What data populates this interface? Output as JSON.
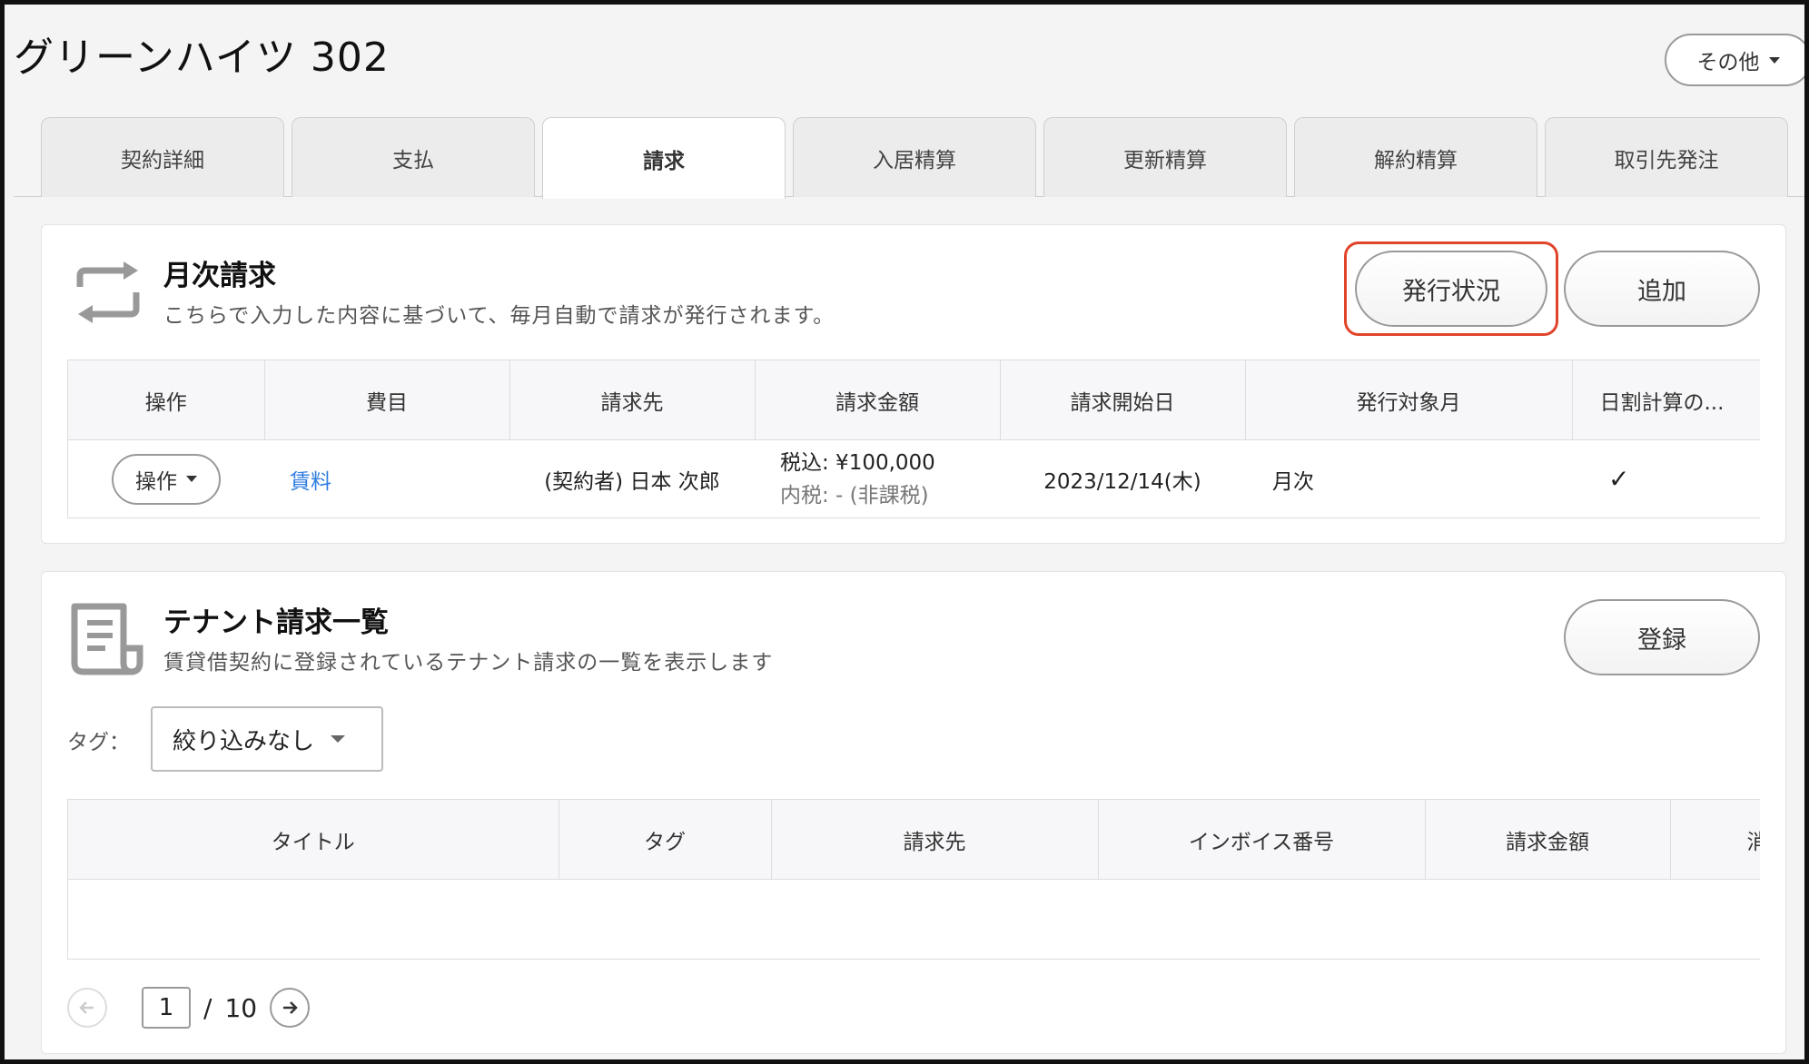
{
  "page": {
    "title": "グリーンハイツ 302",
    "other_label": "その他"
  },
  "tabs": [
    {
      "label": "契約詳細",
      "active": false
    },
    {
      "label": "支払",
      "active": false
    },
    {
      "label": "請求",
      "active": true
    },
    {
      "label": "入居精算",
      "active": false
    },
    {
      "label": "更新精算",
      "active": false
    },
    {
      "label": "解約精算",
      "active": false
    },
    {
      "label": "取引先発注",
      "active": false
    }
  ],
  "monthly": {
    "title": "月次請求",
    "description": "こちらで入力した内容に基づいて、毎月自動で請求が発行されます。",
    "status_button": "発行状況",
    "add_button": "追加",
    "columns": [
      "操作",
      "費目",
      "請求先",
      "請求金額",
      "請求開始日",
      "発行対象月",
      "日割計算の..."
    ],
    "rows": [
      {
        "action": "操作",
        "item": "賃料",
        "billing_to": "(契約者) 日本 次郎",
        "amount_main": "税込: ¥100,000",
        "amount_sub": "内税: - (非課税)",
        "start_date": "2023/12/14(木)",
        "target_month": "月次",
        "prorate": "✓"
      }
    ]
  },
  "tenant": {
    "title": "テナント請求一覧",
    "description": "賃貸借契約に登録されているテナント請求の一覧を表示します",
    "register_button": "登録",
    "tag_label": "タグ：",
    "tag_value": "絞り込みなし",
    "columns": [
      "タイトル",
      "タグ",
      "請求先",
      "インボイス番号",
      "請求金額",
      "消"
    ],
    "pager": {
      "current": "1",
      "separator": "/",
      "total": "10"
    }
  },
  "colors": {
    "link": "#2f7de1",
    "highlight": "#e0442a"
  }
}
